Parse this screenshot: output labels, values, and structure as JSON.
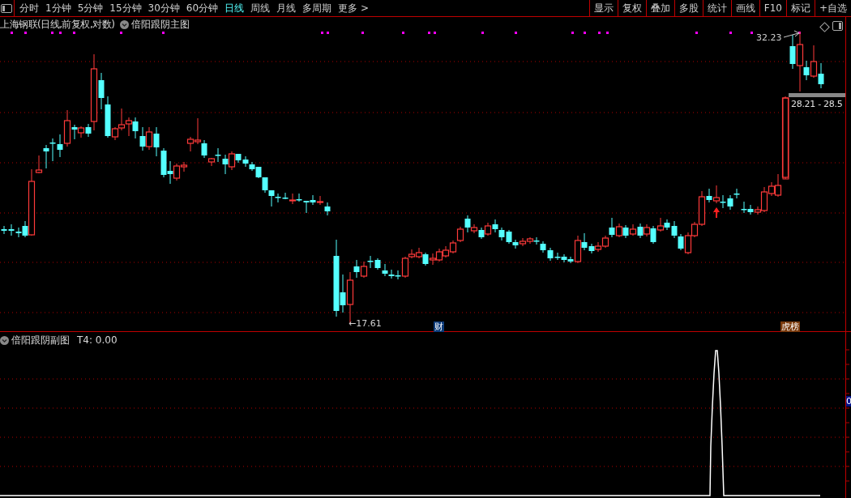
{
  "toolbar": {
    "periods": [
      {
        "label": "分时",
        "selected": false
      },
      {
        "label": "1分钟",
        "selected": false
      },
      {
        "label": "5分钟",
        "selected": false
      },
      {
        "label": "15分钟",
        "selected": false
      },
      {
        "label": "30分钟",
        "selected": false
      },
      {
        "label": "60分钟",
        "selected": false
      },
      {
        "label": "日线",
        "selected": true
      },
      {
        "label": "周线",
        "selected": false
      },
      {
        "label": "月线",
        "selected": false
      },
      {
        "label": "多周期",
        "selected": false
      },
      {
        "label": "更多 >",
        "selected": false
      }
    ],
    "actions": [
      "显示",
      "复权",
      "叠加",
      "多股",
      "统计",
      "画线",
      "F10",
      "标记",
      "+自选"
    ]
  },
  "main_pane": {
    "title": "上海钢联(日线,前复权,对数)",
    "indicator": "倍阳跟阴主图",
    "high_label": "32.23",
    "low_label": "←17.61",
    "range_tooltip": "28.21 - 28.5",
    "badges": [
      {
        "label": "财",
        "kind": "finance"
      },
      {
        "label": "虎榜",
        "kind": "ranking"
      }
    ]
  },
  "sub_pane": {
    "indicator": "倍阳跟阴副图",
    "reading": "T4: 0.00",
    "axis_value": "0"
  }
}
